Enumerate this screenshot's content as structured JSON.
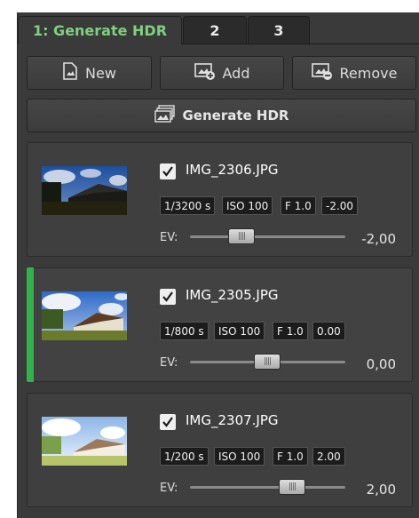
{
  "tabs": [
    {
      "label": "1: Generate HDR",
      "active": true
    },
    {
      "label": "2",
      "active": false
    },
    {
      "label": "3",
      "active": false
    }
  ],
  "toolbar": {
    "new_label": "New",
    "add_label": "Add",
    "remove_label": "Remove",
    "generate_label": "Generate HDR"
  },
  "images": [
    {
      "filename": "IMG_2306.JPG",
      "checked": true,
      "shutter": "1/3200 s",
      "iso": "ISO 100",
      "aperture": "F 1.0",
      "exposure": "-2.00",
      "ev_label": "EV:",
      "ev_value": "-2,00",
      "selected": false
    },
    {
      "filename": "IMG_2305.JPG",
      "checked": true,
      "shutter": "1/800 s",
      "iso": "ISO 100",
      "aperture": "F 1.0",
      "exposure": "0.00",
      "ev_label": "EV:",
      "ev_value": "0,00",
      "selected": true
    },
    {
      "filename": "IMG_2307.JPG",
      "checked": true,
      "shutter": "1/200 s",
      "iso": "ISO 100",
      "aperture": "F 1.0",
      "exposure": "2.00",
      "ev_label": "EV:",
      "ev_value": "2,00",
      "selected": false
    }
  ],
  "colors": {
    "active_tab_text": "#7fd07f",
    "selection_bar": "#2fb34a",
    "panel_bg": "#3a3a3a"
  },
  "icons": [
    "new-image-icon",
    "add-image-icon",
    "remove-image-icon",
    "generate-hdr-icon",
    "checkmark-icon",
    "slider-grip-icon"
  ]
}
